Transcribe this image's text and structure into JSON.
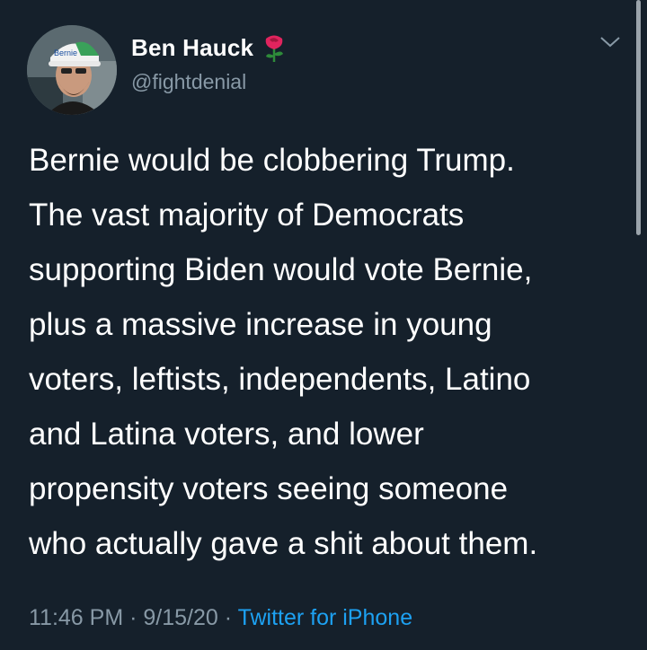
{
  "author": {
    "display_name": "Ben Hauck",
    "handle": "@fightdenial",
    "badge_icon": "rose-icon",
    "avatar_hat_text": "Bernie"
  },
  "tweet": {
    "text": "Bernie would be clobbering Trump.\nThe vast majority of Democrats\nsupporting Biden would vote Bernie,\nplus a massive increase in young\nvoters, leftists, independents, Latino\nand Latina voters, and lower\npropensity voters seeing someone\nwho actually gave a shit about them."
  },
  "meta": {
    "time": "11:46 PM",
    "separator": " · ",
    "date": "9/15/20",
    "source": "Twitter for iPhone"
  },
  "menu_icon": "chevron-down-icon",
  "colors": {
    "background": "#15202b",
    "text": "#ffffff",
    "secondary_text": "#8899a6",
    "link": "#1da1f2",
    "rose": "#e0245e"
  }
}
